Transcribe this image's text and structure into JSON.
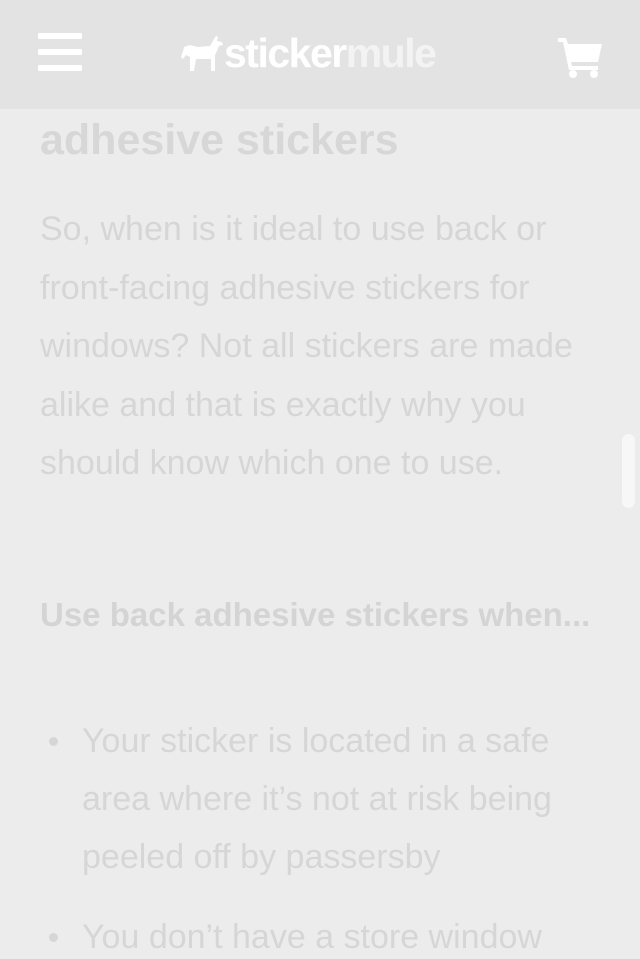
{
  "header": {
    "menu_icon": "hamburger-menu-icon",
    "logo": {
      "part1": "sticker",
      "part2": "mule",
      "icon": "mule-horse-icon"
    },
    "cart_icon": "shopping-cart-icon"
  },
  "article": {
    "heading_fragment": "adhesive stickers",
    "paragraph": "So, when is it ideal to use back or front-facing adhesive stickers for windows? Not all stickers are made alike and that is exactly why you should know which one to use.",
    "subheading": "Use back adhesive stickers when...",
    "bullets": [
      "Your sticker is located in a safe area where it’s not at risk being peeled off by passersby",
      "You don’t have a store window"
    ]
  },
  "colors": {
    "header_bg": "#e3e3e3",
    "page_bg": "#ececec",
    "text": "#d6d6d6"
  }
}
